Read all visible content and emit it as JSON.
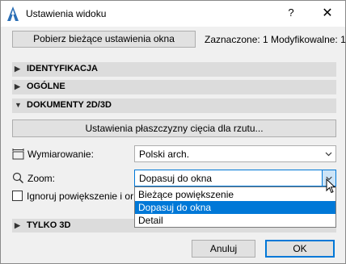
{
  "window": {
    "title": "Ustawienia widoku",
    "help_label": "?",
    "close_label": "✕"
  },
  "top": {
    "get_settings_label": "Pobierz bieżące ustawienia okna",
    "selection_info": "Zaznaczone: 1 Modyfikowalne: 1"
  },
  "sections": {
    "identyfikacja": "IDENTYFIKACJA",
    "ogolne": "OGÓLNE",
    "dokumenty": "DOKUMENTY 2D/3D",
    "tylko3d": "TYLKO 3D"
  },
  "documents": {
    "cut_plane_button": "Ustawienia płaszczyzny cięcia dla rzutu...",
    "dimensioning_label": "Wymiarowanie:",
    "dimensioning_value": "Polski arch.",
    "zoom_label": "Zoom:",
    "zoom_value": "Dopasuj do okna",
    "ignore_zoom_label": "Ignoruj powiększenie i ori",
    "zoom_options": [
      "Bieżące powiększenie",
      "Dopasuj do okna",
      "Detail"
    ],
    "zoom_selected_index": 1
  },
  "footer": {
    "cancel_label": "Anuluj",
    "ok_label": "OK"
  },
  "colors": {
    "accent": "#0078d7",
    "section_bg": "#dcdcdc",
    "dialog_bg": "#f0f0f0"
  },
  "icons": {
    "app": "archicad-logo-icon",
    "dimension": "dimension-icon",
    "zoom": "magnifier-icon"
  }
}
